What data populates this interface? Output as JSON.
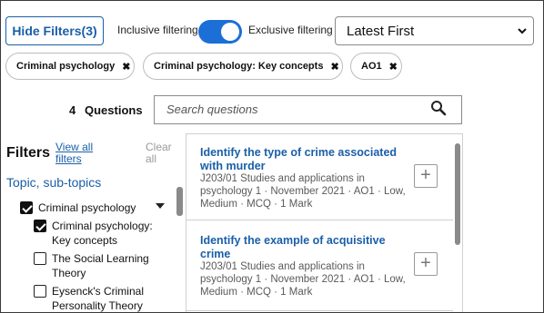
{
  "controls": {
    "hide_filters_label": "Hide Filters(3)",
    "inclusive_label": "Inclusive filtering",
    "exclusive_label": "Exclusive filtering",
    "toggle_state": "exclusive",
    "sort_selected": "Latest First"
  },
  "chips": [
    {
      "label": "Criminal psychology",
      "remove_icon": "close-icon"
    },
    {
      "label": "Criminal psychology: Key concepts",
      "remove_icon": "close-icon"
    },
    {
      "label": "AO1",
      "remove_icon": "close-icon"
    }
  ],
  "search": {
    "count": "4",
    "count_label": "Questions",
    "placeholder": "Search questions",
    "icon": "search-icon"
  },
  "filters": {
    "title": "Filters",
    "view_all": "View all filters",
    "clear_all": "Clear all",
    "section_title": "Topic, sub-topics",
    "items": [
      {
        "label": "Criminal psychology",
        "checked": true,
        "expandable": true
      },
      {
        "label": "Criminal psychology: Key concepts",
        "checked": true
      },
      {
        "label": "The Social Learning Theory",
        "checked": false
      },
      {
        "label": "Eysenck's Criminal Personality Theory",
        "checked": false
      }
    ]
  },
  "questions": [
    {
      "title": "Identify the type of crime associated with murder",
      "meta": "J203/01 Studies and applications in psychology 1 · November 2021 · AO1 · Low, Medium · MCQ · 1 Mark",
      "add_icon": "plus-icon"
    },
    {
      "title": "Identify the example of acquisitive crime",
      "meta": "J203/01 Studies and applications in psychology 1 · November 2021 · AO1 · Low, Medium · MCQ · 1 Mark",
      "add_icon": "plus-icon"
    }
  ],
  "colors": {
    "accent": "#1a5fa8",
    "toggle_on": "#1b6fd6",
    "muted": "#5a5a5a"
  }
}
